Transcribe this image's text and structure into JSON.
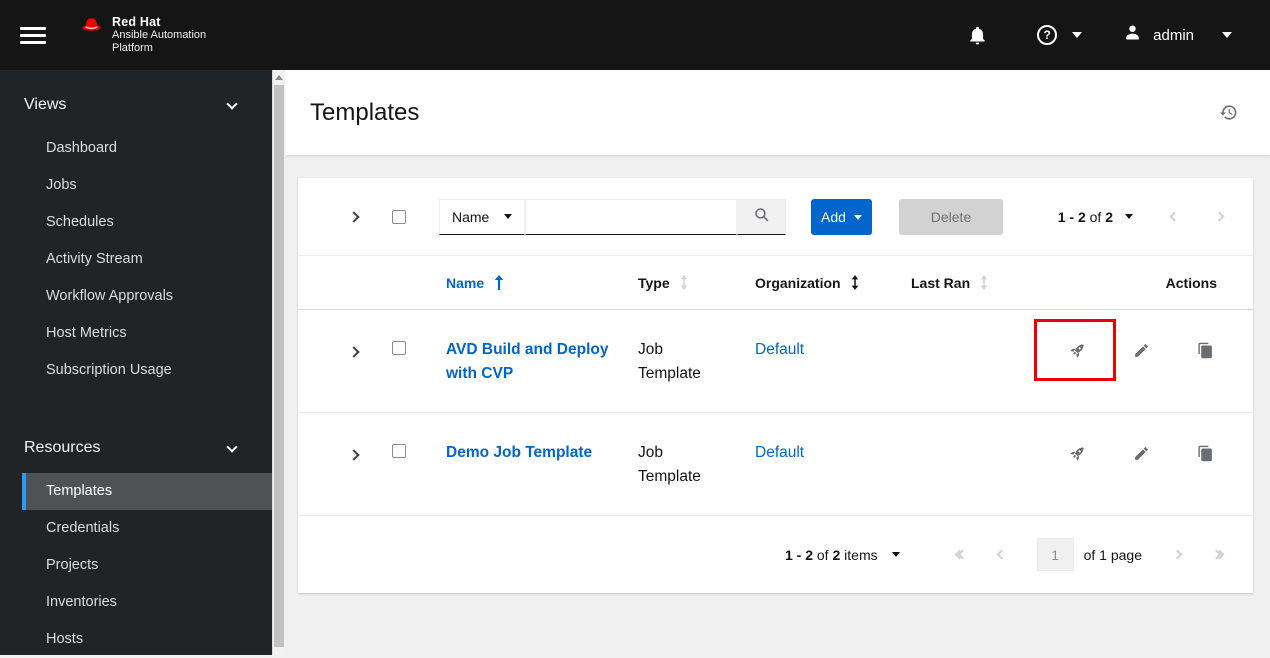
{
  "colors": {
    "masthead_bg": "#151515",
    "sidebar_bg": "#212427",
    "active_nav_bg": "#4f5255",
    "active_nav_border": "#2b9af3",
    "link_blue": "#0066cc",
    "primary_button_bg": "#0066cc",
    "disabled_button_bg": "#d2d2d2",
    "content_bg": "#f0f0f0",
    "action_icon_gray": "#6a6e73",
    "annotation_highlight_red": "#ee0000"
  },
  "masthead": {
    "brand_line1": "Red Hat",
    "brand_line2": "Ansible Automation",
    "brand_line3": "Platform",
    "help_glyph": "?",
    "username": "admin"
  },
  "sidebar": {
    "groups": [
      {
        "label": "Views",
        "items": [
          "Dashboard",
          "Jobs",
          "Schedules",
          "Activity Stream",
          "Workflow Approvals",
          "Host Metrics",
          "Subscription Usage"
        ]
      },
      {
        "label": "Resources",
        "items": [
          "Templates",
          "Credentials",
          "Projects",
          "Inventories",
          "Hosts"
        ],
        "active_item": "Templates"
      }
    ]
  },
  "page": {
    "title": "Templates"
  },
  "toolbar": {
    "filter_selected": "Name",
    "search_value": "",
    "add_label": "Add",
    "delete_label": "Delete",
    "pagination": {
      "range": "1 - 2",
      "of_label": "of",
      "total": "2"
    }
  },
  "table": {
    "headers": {
      "name": "Name",
      "type": "Type",
      "organization": "Organization",
      "last_ran": "Last Ran",
      "actions": "Actions"
    },
    "rows": [
      {
        "name": "AVD Build and Deploy with CVP",
        "type": "Job Template",
        "organization": "Default",
        "last_ran": ""
      },
      {
        "name": "Demo Job Template",
        "type": "Job Template",
        "organization": "Default",
        "last_ran": ""
      }
    ]
  },
  "pagination_bottom": {
    "range": "1 - 2",
    "of_label": "of",
    "total": "2",
    "items_label": "items",
    "page_value": "1",
    "page_of_label": "of 1 page"
  },
  "annotation": {
    "type": "highlight-box",
    "color": "#ee0000",
    "target": "row-1-launch-button"
  }
}
